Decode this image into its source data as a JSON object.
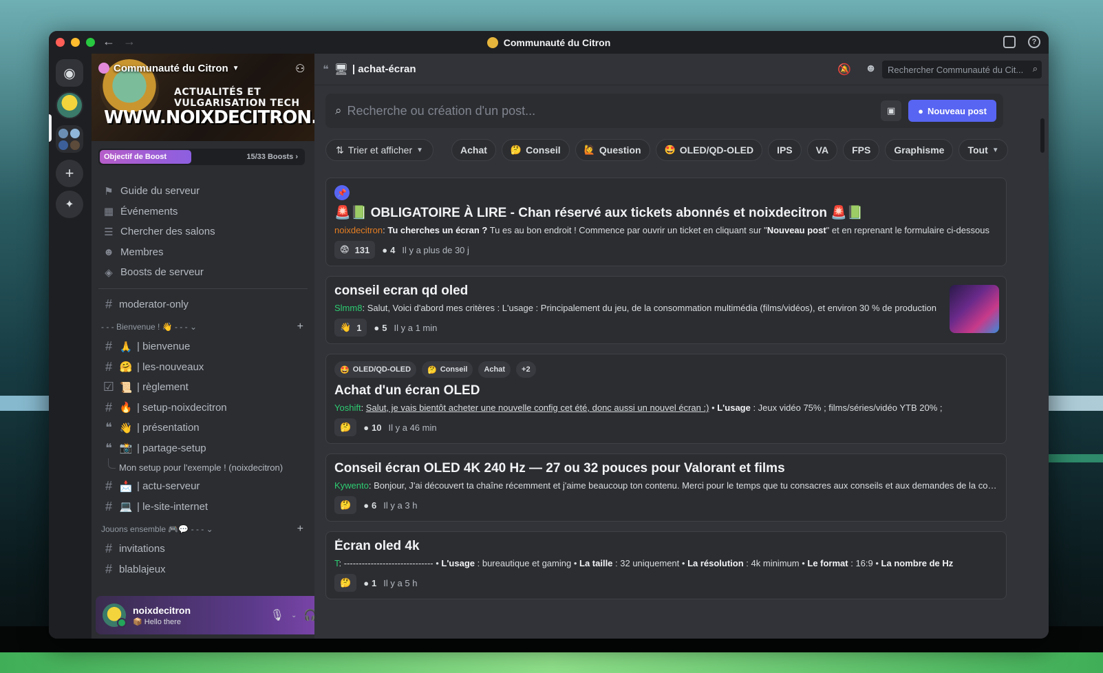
{
  "window": {
    "title": "Communauté du Citron"
  },
  "server": {
    "name": "Communauté du Citron",
    "banner_line1": "ACTUALITÉS ET VULGARISATION TECH",
    "banner_line2": "WWW.NOIXDECITRON.TECH",
    "boost_label": "Objectif de Boost",
    "boost_count": "15/33 Boosts",
    "boost_progress": 0.45
  },
  "sidebar": {
    "menu": [
      {
        "icon": "signpost-icon",
        "glyph": "⚑",
        "label": "Guide du serveur"
      },
      {
        "icon": "calendar-icon",
        "glyph": "▦",
        "label": "Événements"
      },
      {
        "icon": "list-search-icon",
        "glyph": "☰",
        "label": "Chercher des salons"
      },
      {
        "icon": "members-icon",
        "glyph": "☻",
        "label": "Membres"
      },
      {
        "icon": "boost-icon",
        "glyph": "◈",
        "label": "Boosts de serveur"
      }
    ],
    "standalone_channel": "moderator-only",
    "category1": "- - - Bienvenue ! 👋 - - -",
    "category1_channels": [
      {
        "emoji": "🙏",
        "name": "| bienvenue",
        "icon": "hash-icon",
        "glyph": "#"
      },
      {
        "emoji": "🤗",
        "name": "| les-nouveaux",
        "icon": "hash-icon",
        "glyph": "#"
      },
      {
        "emoji": "📜",
        "name": "| règlement",
        "icon": "rules-icon",
        "glyph": "☑"
      },
      {
        "emoji": "🔥",
        "name": "| setup-noixdecitron",
        "icon": "hash-icon",
        "glyph": "#"
      },
      {
        "emoji": "👋",
        "name": "| présentation",
        "icon": "forum-icon",
        "glyph": "❝"
      },
      {
        "emoji": "📸",
        "name": "| partage-setup",
        "icon": "forum-icon",
        "glyph": "❝"
      }
    ],
    "thread": "Mon setup pour l'exemple ! (noixdecitron)",
    "category1_more": [
      {
        "emoji": "📩",
        "name": "| actu-serveur",
        "icon": "hash-icon",
        "glyph": "#"
      },
      {
        "emoji": "💻",
        "name": "| le-site-internet",
        "icon": "hash-icon",
        "glyph": "#"
      }
    ],
    "category2": "Jouons ensemble 🎮💬 - - -",
    "category2_channels": [
      {
        "name": "invitations",
        "icon": "hash-icon",
        "glyph": "#"
      },
      {
        "name": "blablajeux",
        "icon": "hash-icon",
        "glyph": "#"
      }
    ]
  },
  "user": {
    "name": "noixdecitron",
    "status": "📦 Hello there"
  },
  "channel": {
    "name": "| achat-écran",
    "search_placeholder": "Rechercher Communauté du Cit...",
    "post_search_placeholder": "Recherche ou création d'un post...",
    "new_post_label": "Nouveau post",
    "sort_label": "Trier et afficher",
    "tags": [
      {
        "label": "Achat",
        "emoji": ""
      },
      {
        "label": "Conseil",
        "emoji": "🤔"
      },
      {
        "label": "Question",
        "emoji": "🙋"
      },
      {
        "label": "OLED/QD-OLED",
        "emoji": "🤩"
      },
      {
        "label": "IPS",
        "emoji": ""
      },
      {
        "label": "VA",
        "emoji": ""
      },
      {
        "label": "FPS",
        "emoji": ""
      },
      {
        "label": "Graphisme",
        "emoji": ""
      }
    ],
    "all_label": "Tout"
  },
  "posts": [
    {
      "title": "🚨📗 OBLIGATOIRE À LIRE - Chan réservé aux tickets abonnés et noixdecitron 🚨📗",
      "author": "noixdecitron",
      "author_color": "#e67e22",
      "body_bold": "Tu cherches un écran ?",
      "body": " Tu es au bon endroit ! Commence par ouvrir un ticket en cliquant sur \"",
      "body_bold2": "Nouveau post",
      "body_end": "\" et en reprenant le formulaire ci-dessous",
      "reaction_emoji": "😨",
      "reaction_count": "131",
      "comments": "4",
      "ago": "Il y a plus de 30 j"
    },
    {
      "title": "conseil ecran qd oled",
      "author": "Slmm8",
      "author_color": "#2ecc71",
      "body": "Salut, Voici d'abord mes critères : L'usage : Principalement du jeu, de la consommation multimédia (films/vidéos), et environ 30 % de production",
      "reaction_emoji": "👋",
      "reaction_count": "1",
      "comments": "5",
      "ago": "Il y a 1 min"
    },
    {
      "tags": [
        {
          "label": "OLED/QD-OLED",
          "emoji": "🤩"
        },
        {
          "label": "Conseil",
          "emoji": "🤔"
        },
        {
          "label": "Achat",
          "emoji": ""
        },
        {
          "label": "+2",
          "emoji": ""
        }
      ],
      "title": "Achat d'un écran OLED",
      "author": "Yoshift",
      "author_color": "#2ecc71",
      "body_ul": "Salut, je vais bientôt acheter une nouvelle config cet été, donc aussi un nouvel écran :)",
      "body_sep": " • ",
      "body_bold": "L'usage",
      "body": " : Jeux vidéo 75% ; films/séries/vidéo YTB 20% ;",
      "reaction_emoji": "🤔",
      "comments": "10",
      "ago": "Il y a 46 min"
    },
    {
      "title": "Conseil écran OLED 4K 240 Hz — 27 ou 32 pouces pour Valorant et films",
      "author": "Kywento",
      "author_color": "#2ecc71",
      "body": "Bonjour, J'ai découvert ta chaîne récemment et j'aime beaucoup ton contenu. Merci pour le temps que tu consacres aux conseils et aux demandes de la communauté",
      "reaction_emoji": "🤔",
      "comments": "6",
      "ago": "Il y a 3 h"
    },
    {
      "title": "Écran oled 4k",
      "author": "T",
      "author_color": "#2ecc71",
      "body": "------------------------------",
      "spec_list": [
        {
          "k": "L'usage",
          "v": " : bureautique et gaming"
        },
        {
          "k": "La taille",
          "v": " : 32 uniquement"
        },
        {
          "k": "La résolution",
          "v": " : 4k minimum"
        },
        {
          "k": "Le format",
          "v": " : 16:9"
        },
        {
          "k": "La nombre de Hz",
          "v": ""
        }
      ],
      "reaction_emoji": "🤔",
      "comments": "1",
      "ago": "Il y a 5 h"
    }
  ]
}
